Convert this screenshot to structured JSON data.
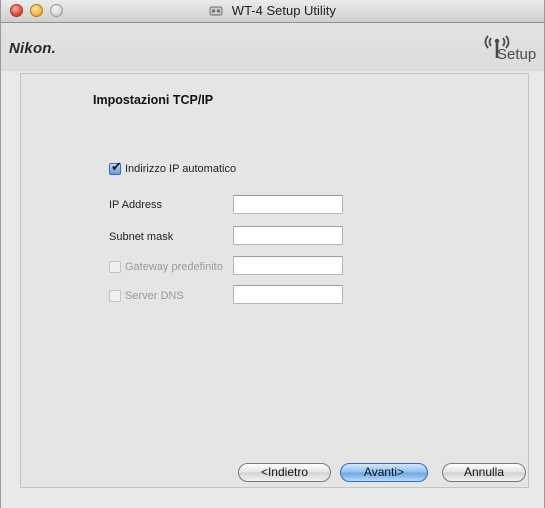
{
  "window": {
    "title": "WT-4 Setup Utility",
    "title_icon": "wt4-app-icon"
  },
  "header": {
    "brand": "Nikon.",
    "setup_logo_text": "Setup",
    "setup_logo_icon": "wireless-antenna-icon"
  },
  "form": {
    "section_title": "Impostazioni TCP/IP",
    "auto_ip": {
      "label": "Indirizzo IP automatico",
      "checked": true
    },
    "ip_address": {
      "label": "IP Address",
      "value": ""
    },
    "subnet_mask": {
      "label": "Subnet mask",
      "value": ""
    },
    "gateway": {
      "label": "Gateway predefinito",
      "checked": false,
      "enabled": false,
      "value": ""
    },
    "dns": {
      "label": "Server DNS",
      "checked": false,
      "enabled": false,
      "value": ""
    }
  },
  "buttons": {
    "back": "<Indietro",
    "next": "Avanti>",
    "cancel": "Annulla"
  },
  "colors": {
    "default_button": "#6aa6e6",
    "checkbox_checked": "#5e9ee6"
  }
}
